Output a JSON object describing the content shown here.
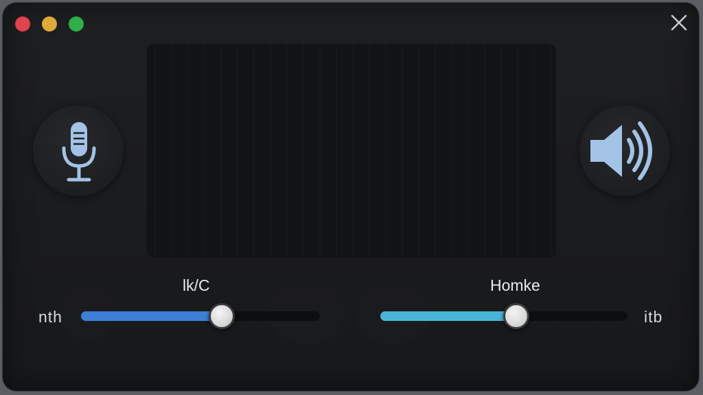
{
  "window": {
    "traffic_lights": [
      {
        "name": "close",
        "color": "#e0444c"
      },
      {
        "name": "minimize",
        "color": "#e0a93a"
      },
      {
        "name": "maximize",
        "color": "#2fae4a"
      }
    ],
    "close_icon": "close-icon"
  },
  "waveform": {
    "colors": {
      "start": "#5ab8e6",
      "end": "#7aa2e8"
    },
    "background": "#121314"
  },
  "mic": {
    "icon": "microphone-icon",
    "color": "#a3c3e6"
  },
  "speaker": {
    "icon": "speaker-icon",
    "color": "#a3c3e6"
  },
  "slider_left": {
    "title": "lk/C",
    "side_label": "nth",
    "value_fraction": 0.59,
    "fill_color": "#3d7fd6"
  },
  "slider_right": {
    "title": "Homke",
    "side_label": "itb",
    "value_fraction": 0.55,
    "fill_color": "#49b4d8"
  }
}
